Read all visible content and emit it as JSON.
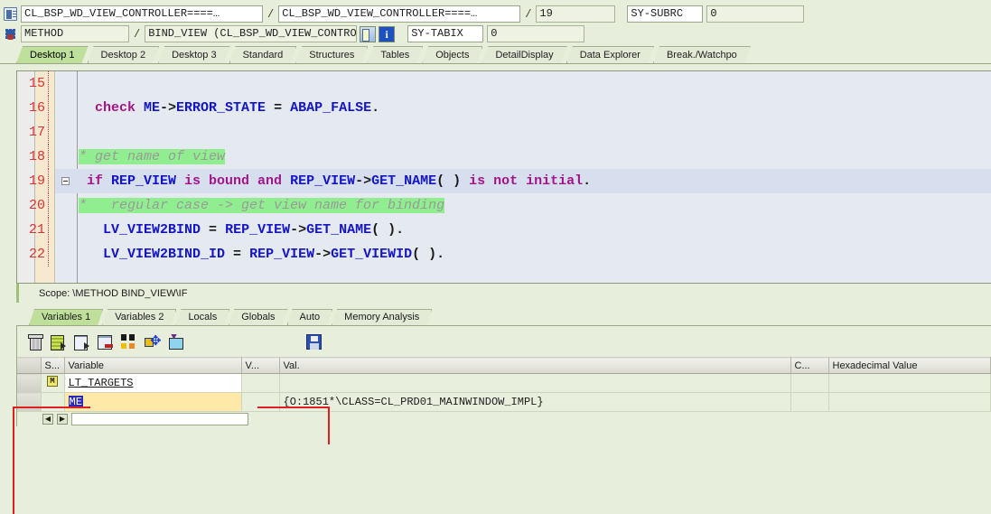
{
  "toolbar": {
    "row1": {
      "icon": "program-doc-icon",
      "object_main": "CL_BSP_WD_VIEW_CONTROLLER====…",
      "sep1": "/",
      "object_include": "CL_BSP_WD_VIEW_CONTROLLER====…",
      "sep2": "/",
      "line_number": "19",
      "sy_subrc_label": "SY-SUBRC",
      "sy_subrc_value": "0"
    },
    "row2": {
      "icon": "debug-gear-icon",
      "event_type": "METHOD",
      "sep1": "/",
      "event_name": "BIND_VIEW (CL_BSP_WD_VIEW_CONTROLLER)",
      "btn_table": "table-icon",
      "btn_info": "info-icon",
      "sy_tabix_label": "SY-TABIX",
      "sy_tabix_value": "0"
    }
  },
  "main_tabs": [
    {
      "label": "Desktop 1",
      "active": true
    },
    {
      "label": "Desktop 2",
      "active": false
    },
    {
      "label": "Desktop 3",
      "active": false
    },
    {
      "label": "Standard",
      "active": false
    },
    {
      "label": "Structures",
      "active": false
    },
    {
      "label": "Tables",
      "active": false
    },
    {
      "label": "Objects",
      "active": false
    },
    {
      "label": "DetailDisplay",
      "active": false
    },
    {
      "label": "Data Explorer",
      "active": false
    },
    {
      "label": "Break./Watchpo",
      "active": false
    }
  ],
  "editor": {
    "lines": [
      {
        "num": "15",
        "marker": "",
        "fold": false,
        "current": false,
        "tokens": []
      },
      {
        "num": "16",
        "marker": "",
        "fold": false,
        "current": false,
        "tokens": [
          {
            "t": "  check ",
            "c": "k"
          },
          {
            "t": "ME",
            "c": "v"
          },
          {
            "t": "->",
            "c": "op"
          },
          {
            "t": "ERROR_STATE",
            "c": "v"
          },
          {
            "t": " = ",
            "c": "op"
          },
          {
            "t": "ABAP_FALSE",
            "c": "v"
          },
          {
            "t": ".",
            "c": "op"
          }
        ]
      },
      {
        "num": "17",
        "marker": "",
        "fold": false,
        "current": false,
        "tokens": []
      },
      {
        "num": "18",
        "marker": "",
        "fold": false,
        "current": false,
        "tokens": [
          {
            "t": "* get name of view",
            "c": "cm"
          }
        ]
      },
      {
        "num": "19",
        "marker": "⇨",
        "fold": true,
        "current": true,
        "tokens": [
          {
            "t": " if ",
            "c": "k"
          },
          {
            "t": "REP_VIEW",
            "c": "v"
          },
          {
            "t": " is bound and ",
            "c": "k"
          },
          {
            "t": "REP_VIEW",
            "c": "v"
          },
          {
            "t": "->",
            "c": "op"
          },
          {
            "t": "GET_NAME",
            "c": "v"
          },
          {
            "t": "( )",
            "c": "op"
          },
          {
            "t": " is not initial",
            "c": "k"
          },
          {
            "t": ".",
            "c": "op"
          }
        ]
      },
      {
        "num": "20",
        "marker": "",
        "fold": false,
        "current": false,
        "tokens": [
          {
            "t": "*   regular case -> get view name for binding",
            "c": "cm"
          }
        ]
      },
      {
        "num": "21",
        "marker": "",
        "fold": false,
        "current": false,
        "tokens": [
          {
            "t": "   ",
            "c": "op"
          },
          {
            "t": "LV_VIEW2BIND",
            "c": "v"
          },
          {
            "t": " = ",
            "c": "op"
          },
          {
            "t": "REP_VIEW",
            "c": "v"
          },
          {
            "t": "->",
            "c": "op"
          },
          {
            "t": "GET_NAME",
            "c": "v"
          },
          {
            "t": "( ).",
            "c": "op"
          }
        ]
      },
      {
        "num": "22",
        "marker": "",
        "fold": false,
        "current": false,
        "tokens": [
          {
            "t": "   ",
            "c": "op"
          },
          {
            "t": "LV_VIEW2BIND_ID",
            "c": "v"
          },
          {
            "t": " = ",
            "c": "op"
          },
          {
            "t": "REP_VIEW",
            "c": "v"
          },
          {
            "t": "->",
            "c": "op"
          },
          {
            "t": "GET_VIEWID",
            "c": "v"
          },
          {
            "t": "( ).",
            "c": "op"
          }
        ]
      }
    ]
  },
  "scope": {
    "text": "Scope: \\METHOD BIND_VIEW\\IF"
  },
  "bottom_tabs": [
    {
      "label": "Variables 1",
      "active": true
    },
    {
      "label": "Variables 2",
      "active": false
    },
    {
      "label": "Locals",
      "active": false
    },
    {
      "label": "Globals",
      "active": false
    },
    {
      "label": "Auto",
      "active": false
    },
    {
      "label": "Memory Analysis",
      "active": false
    }
  ],
  "bottom_toolbar": [
    {
      "name": "delete-variable-icon"
    },
    {
      "name": "list-export-icon"
    },
    {
      "name": "detail-display-icon"
    },
    {
      "name": "remove-row-icon"
    },
    {
      "name": "download-all-icon"
    },
    {
      "name": "move-variable-icon"
    },
    {
      "name": "folder-icon"
    },
    {
      "name": "save-icon"
    }
  ],
  "table": {
    "headers": [
      "",
      "S...",
      "Variable",
      "V...",
      "Val.",
      "C...",
      "Hexadecimal Value"
    ],
    "rows": [
      {
        "select": "",
        "s": "flag-icon",
        "variable": "LT_TARGETS",
        "v": "",
        "val": "",
        "c": "",
        "hex": "",
        "variable_style": "white"
      },
      {
        "select": "",
        "s": "",
        "variable": "ME",
        "v": "",
        "val": "{O:1851*\\CLASS=CL_PRD01_MAINWINDOW_IMPL}",
        "c": "",
        "hex": "",
        "variable_style": "amber"
      }
    ]
  },
  "colors": {
    "window_bg": "#e8eedc",
    "tab_active": "#bfe09a",
    "editor_bg": "#e4eaf0",
    "line_number": "#e03030",
    "keyword": "#a2158a",
    "identifier": "#1414c8",
    "comment_highlight": "#90ee90",
    "current_line": "#d7dfee",
    "annotation": "#e02020"
  }
}
